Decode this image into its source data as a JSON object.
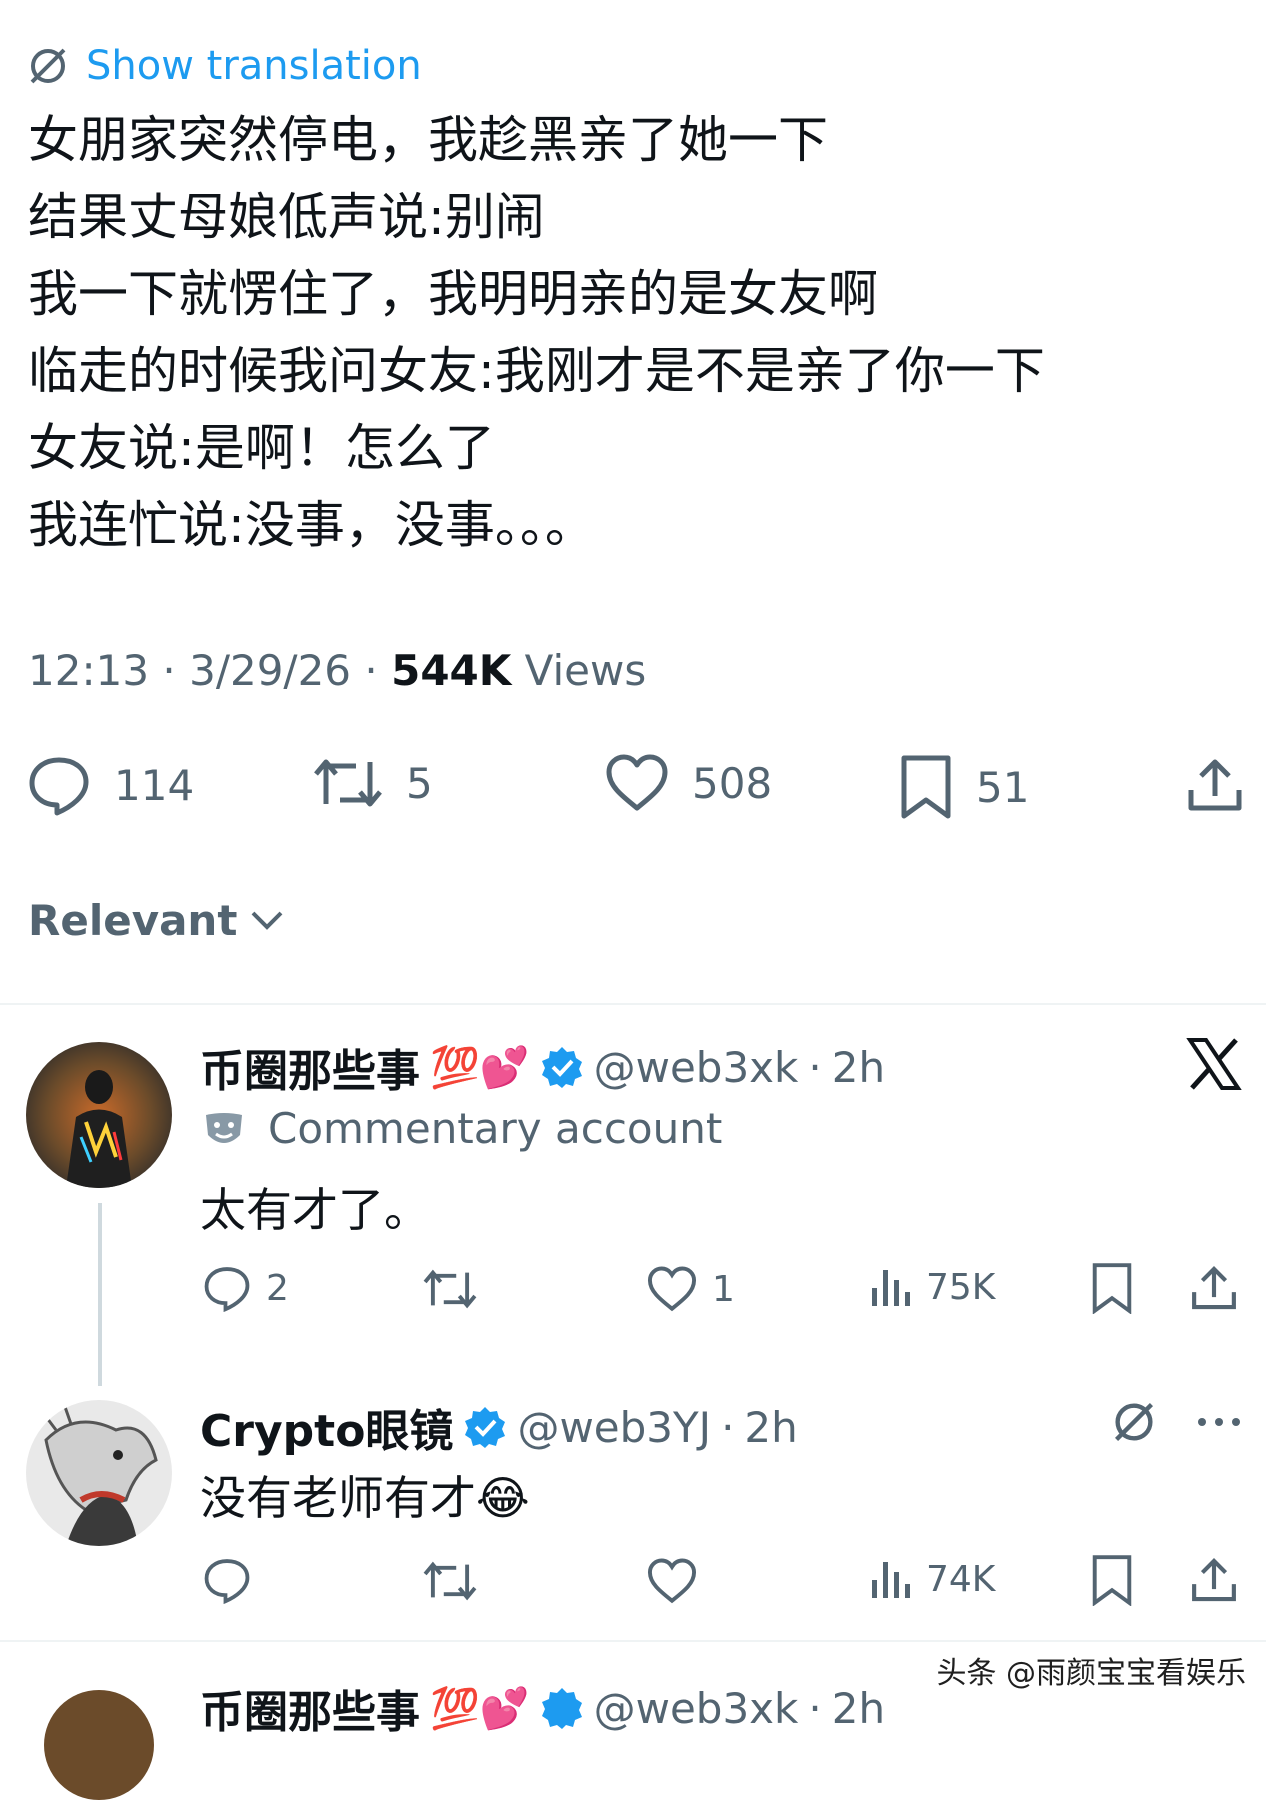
{
  "translate": {
    "label": "Show translation",
    "icon": "translate-icon"
  },
  "tweet": {
    "lines": [
      "女朋家突然停电，我趁黑亲了她一下",
      "结果丈母娘低声说:别闹",
      "我一下就愣住了，我明明亲的是女友啊",
      "临走的时候我问女友:我刚才是不是亲了你一下",
      "女友说:是啊！怎么了",
      "我连忙说:没事，没事。。。"
    ],
    "time": "12:13",
    "date": "3/29/26",
    "views_count": "544K",
    "views_label": "Views",
    "actions": {
      "replies": "114",
      "reposts": "5",
      "likes": "508",
      "bookmarks": "51"
    }
  },
  "sort": {
    "label": "Relevant"
  },
  "replies": [
    {
      "name": "币圈那些事",
      "emojis": "💯💕",
      "handle": "@web3xk",
      "time": "2h",
      "label": "Commentary account",
      "text": "太有才了。",
      "stats": {
        "replies": "2",
        "reposts": "",
        "likes": "1",
        "views": "75K"
      }
    },
    {
      "name": "Crypto眼镜",
      "handle": "@web3YJ",
      "time": "2h",
      "text": "没有老师有才😂",
      "stats": {
        "replies": "",
        "reposts": "",
        "likes": "",
        "views": "74K"
      }
    },
    {
      "name": "币圈那些事",
      "emojis": "💯💕",
      "handle": "@web3xk",
      "time": "2h"
    }
  ],
  "watermark": "头条 @雨颜宝宝看娱乐",
  "colors": {
    "accent": "#1d9bf0",
    "muted": "#536471",
    "text": "#0f1419",
    "verified": "#1d9bf0"
  }
}
